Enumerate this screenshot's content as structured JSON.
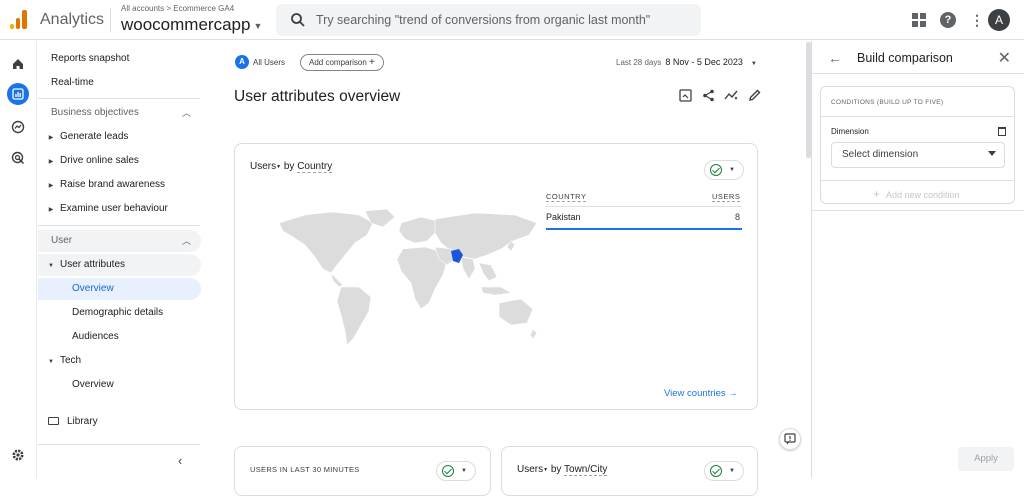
{
  "header": {
    "app_name": "Analytics",
    "breadcrumb": "All accounts > Ecommerce GA4",
    "property": "woocommercapp",
    "search_placeholder": "Try searching \"trend of conversions from organic last month\"",
    "avatar_letter": "A",
    "help_glyph": "?",
    "kebab_glyph": "⋮"
  },
  "nav": {
    "reports_snapshot": "Reports snapshot",
    "realtime": "Real-time",
    "business_objectives": "Business objectives",
    "bo_items": [
      "Generate leads",
      "Drive online sales",
      "Raise brand awareness",
      "Examine user behaviour"
    ],
    "user": "User",
    "user_attributes": "User attributes",
    "ua_items": [
      "Overview",
      "Demographic details",
      "Audiences"
    ],
    "tech": "Tech",
    "tech_items": [
      "Overview"
    ],
    "library": "Library"
  },
  "toolbar": {
    "all_users_badge": "A",
    "all_users": "All Users",
    "add_comparison": "Add comparison",
    "date_label": "Last 28 days",
    "date_range": "8 Nov - 5 Dec 2023"
  },
  "page": {
    "title": "User attributes overview"
  },
  "country_card": {
    "title_metric": "Users",
    "title_by": " by ",
    "title_dim": "Country",
    "col_country": "COUNTRY",
    "col_users": "USERS",
    "rows": [
      {
        "country": "Pakistan",
        "users": "8"
      }
    ],
    "view_link": "View countries"
  },
  "card_users30": {
    "title": "USERS IN LAST 30 MINUTES"
  },
  "card_city": {
    "title_metric": "Users",
    "title_by": " by ",
    "title_dim": "Town/City"
  },
  "panel": {
    "title": "Build comparison",
    "conditions_header": "CONDITIONS (BUILD UP TO FIVE)",
    "dimension_label": "Dimension",
    "select_value": "Select dimension",
    "add_condition": "Add new condition",
    "apply": "Apply"
  },
  "colors": {
    "accent": "#1a73e8",
    "highlight_country": "#1a56db",
    "map_land": "#dcdcdc"
  }
}
